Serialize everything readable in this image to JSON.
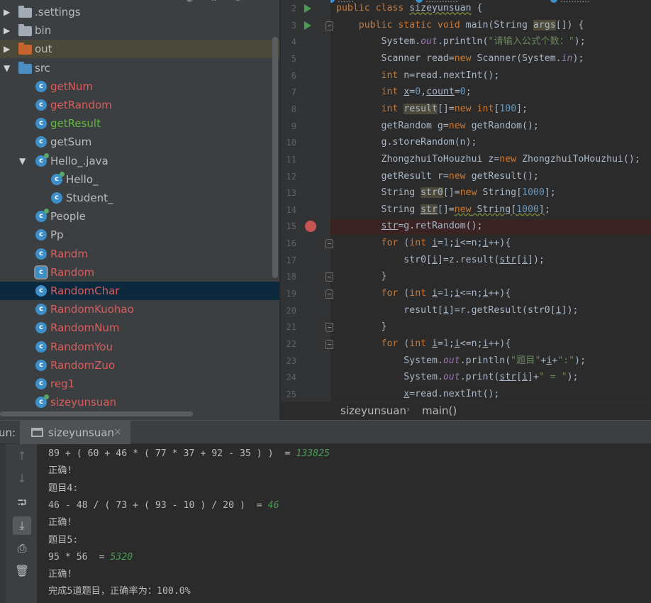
{
  "project": {
    "tree": [
      {
        "label": ".settings",
        "type": "folder-grey",
        "depth": 0,
        "arrow": "▶",
        "color": "normal"
      },
      {
        "label": "bin",
        "type": "folder-grey",
        "depth": 0,
        "arrow": "▶",
        "color": "normal"
      },
      {
        "label": "out",
        "type": "folder-orange",
        "depth": 0,
        "arrow": "▶",
        "color": "normal",
        "highlight": "out"
      },
      {
        "label": "src",
        "type": "folder-blue",
        "depth": 0,
        "arrow": "▼",
        "color": "normal"
      },
      {
        "label": "getNum",
        "type": "class",
        "depth": 1,
        "color": "red"
      },
      {
        "label": "getRandom",
        "type": "class",
        "depth": 1,
        "color": "red"
      },
      {
        "label": "getResult",
        "type": "class",
        "depth": 1,
        "color": "green"
      },
      {
        "label": "getSum",
        "type": "class",
        "depth": 1,
        "color": "normal"
      },
      {
        "label": "Hello_.java",
        "type": "class-runnable",
        "depth": 1,
        "arrow": "▼",
        "color": "normal"
      },
      {
        "label": "Hello_",
        "type": "class-runnable",
        "depth": 2,
        "color": "normal"
      },
      {
        "label": "Student_",
        "type": "class",
        "depth": 2,
        "color": "normal"
      },
      {
        "label": "People",
        "type": "class-runnable",
        "depth": 1,
        "color": "normal"
      },
      {
        "label": "Pp",
        "type": "class",
        "depth": 1,
        "color": "normal"
      },
      {
        "label": "Randm",
        "type": "class",
        "depth": 1,
        "color": "red"
      },
      {
        "label": "Random",
        "type": "class-boxed",
        "depth": 1,
        "color": "red"
      },
      {
        "label": "RandomChar",
        "type": "class",
        "depth": 1,
        "color": "red",
        "highlight": "selected"
      },
      {
        "label": "RandomKuohao",
        "type": "class",
        "depth": 1,
        "color": "red"
      },
      {
        "label": "RandomNum",
        "type": "class",
        "depth": 1,
        "color": "red"
      },
      {
        "label": "RandomYou",
        "type": "class",
        "depth": 1,
        "color": "red"
      },
      {
        "label": "RandomZuo",
        "type": "class",
        "depth": 1,
        "color": "red"
      },
      {
        "label": "reg1",
        "type": "class",
        "depth": 1,
        "color": "red"
      },
      {
        "label": "sizeyunsuan",
        "type": "class-runnable",
        "depth": 1,
        "color": "red"
      }
    ]
  },
  "editor": {
    "lines": [
      {
        "n": "2",
        "gutter": "run",
        "code": "<span class=\"tk-kw\">public class</span> <span class=\"tk-wave\">sizeyunsuan</span> {"
      },
      {
        "n": "3",
        "gutter": "run",
        "fold": "down",
        "code": "    <span class=\"tk-kw\">public static void</span> main(String <span class=\"tk-hl\">args</span>[]) {"
      },
      {
        "n": "4",
        "code": "        System.<span class=\"tk-field\">out</span>.println(<span class=\"tk-str\">\"请输入公式个数：\"</span>);"
      },
      {
        "n": "5",
        "code": "        Scanner read=<span class=\"tk-kw\">new</span> Scanner(System.<span class=\"tk-field\">in</span>);"
      },
      {
        "n": "6",
        "code": "        <span class=\"tk-kw\">int</span> n=read.nextInt();"
      },
      {
        "n": "7",
        "code": "        <span class=\"tk-kw\">int</span> <span class=\"tk-var\">x</span>=<span class=\"tk-num\">0</span>,<span class=\"tk-var\">count</span>=<span class=\"tk-num\">0</span>;"
      },
      {
        "n": "8",
        "code": "        <span class=\"tk-kw\">int</span> <span class=\"tk-hl\">result</span>[]=<span class=\"tk-kw\">new int</span>[<span class=\"tk-num\">100</span>];"
      },
      {
        "n": "9",
        "code": "        getRandom g=<span class=\"tk-kw\">new</span> getRandom();"
      },
      {
        "n": "10",
        "code": "        g.storeRandom(n);"
      },
      {
        "n": "11",
        "code": "        ZhongzhuiToHouzhui z=<span class=\"tk-kw\">new</span> ZhongzhuiToHouzhui();"
      },
      {
        "n": "12",
        "code": "        getResult r=<span class=\"tk-kw\">new</span> getResult();"
      },
      {
        "n": "13",
        "code": "        String <span class=\"tk-hl\">str0</span>[]=<span class=\"tk-kw\">new</span> String[<span class=\"tk-num\">1000</span>];"
      },
      {
        "n": "14",
        "code": "        String <span class=\"tk-var tk-hl\">str</span>[]=<span class=\"tk-wave\"><span class=\"tk-kw\">new</span> String[<span class=\"tk-num\">1000</span>]</span>;"
      },
      {
        "n": "15",
        "gutter": "breakpoint",
        "code": "        <span class=\"tk-var\">str</span>=g.retRandom();"
      },
      {
        "n": "16",
        "fold": "down",
        "code": "        <span class=\"tk-kw\">for</span> (<span class=\"tk-kw\">int</span> <span class=\"tk-var\">i</span>=<span class=\"tk-num\">1</span>;<span class=\"tk-var\">i</span>&lt;=n;<span class=\"tk-var\">i</span>++){"
      },
      {
        "n": "17",
        "code": "            str0[<span class=\"tk-var\">i</span>]=z.result(<span class=\"tk-var\">str</span>[<span class=\"tk-var\">i</span>]);"
      },
      {
        "n": "18",
        "fold": "up",
        "code": "        }"
      },
      {
        "n": "19",
        "fold": "down",
        "code": "        <span class=\"tk-kw\">for</span> (<span class=\"tk-kw\">int</span> <span class=\"tk-var\">i</span>=<span class=\"tk-num\">1</span>;<span class=\"tk-var\">i</span>&lt;=n;<span class=\"tk-var\">i</span>++){"
      },
      {
        "n": "20",
        "code": "            result[<span class=\"tk-var\">i</span>]=r.getResult(str0[<span class=\"tk-var\">i</span>]);"
      },
      {
        "n": "21",
        "fold": "up",
        "code": "        }"
      },
      {
        "n": "22",
        "fold": "down",
        "code": "        <span class=\"tk-kw\">for</span> (<span class=\"tk-kw\">int</span> <span class=\"tk-var\">i</span>=<span class=\"tk-num\">1</span>;<span class=\"tk-var\">i</span>&lt;=n;<span class=\"tk-var\">i</span>++){"
      },
      {
        "n": "23",
        "code": "            System.<span class=\"tk-field\">out</span>.println(<span class=\"tk-str\">\"题目\"</span>+<span class=\"tk-var\">i</span>+<span class=\"tk-str\">\":\"</span>);"
      },
      {
        "n": "24",
        "code": "            System.<span class=\"tk-field\">out</span>.print(<span class=\"tk-var\">str</span>[<span class=\"tk-var\">i</span>]+<span class=\"tk-str\">\" = \"</span>);"
      },
      {
        "n": "25",
        "code": "            <span class=\"tk-var\">x</span>=read.nextInt();"
      }
    ]
  },
  "breadcrumb": {
    "first": "sizeyunsuan",
    "second": "main()"
  },
  "run": {
    "label": "un:",
    "tab_label": "sizeyunsuan",
    "tab_close": "×",
    "console": [
      {
        "text": "89 + ( 60 + 46 * ( 77 * 37 + 92 - 35 ) )  = ",
        "answer": "133825"
      },
      {
        "text": "正确!"
      },
      {
        "text": "题目4:"
      },
      {
        "text": "46 - 48 / ( 73 + ( 93 - 10 ) / 20 )  = ",
        "answer": "46"
      },
      {
        "text": "正确!"
      },
      {
        "text": "题目5:"
      },
      {
        "text": "95 * 56  = ",
        "answer": "5320"
      },
      {
        "text": "正确!"
      },
      {
        "text": "完成5道题目，正确率为：100.0%"
      }
    ]
  },
  "colors": {
    "accent": "#4a88c7",
    "selection": "#0d293e",
    "keyword": "#cc7832",
    "string": "#6a8759",
    "number": "#6897bb",
    "input_echo": "#499c54",
    "breakpoint": "#c75450"
  }
}
